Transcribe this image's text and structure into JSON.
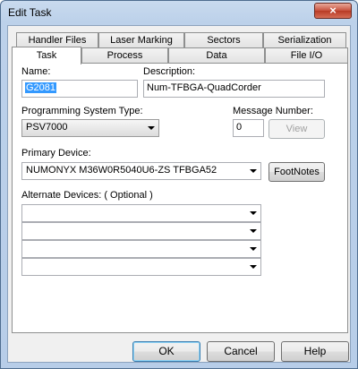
{
  "window": {
    "title": "Edit Task",
    "close_glyph": "×"
  },
  "tabs_row1": [
    "Handler Files",
    "Laser Marking",
    "Sectors",
    "Serialization"
  ],
  "tabs_row2": [
    "Task",
    "Process",
    "Data",
    "File I/O"
  ],
  "form": {
    "name_label": "Name:",
    "name_value": "G2081",
    "description_label": "Description:",
    "description_value": "Num-TFBGA-QuadCorder",
    "programming_system_label": "Programming System Type:",
    "programming_system_value": "PSV7000",
    "message_number_label": "Message Number:",
    "message_number_value": "0",
    "view_button": "View",
    "primary_device_label": "Primary Device:",
    "primary_device_value": "NUMONYX M36W0R5040U6-ZS TFBGA52",
    "footnotes_button": "FootNotes",
    "alternate_devices_label": "Alternate Devices: ( Optional )",
    "alternate_devices": [
      "",
      "",
      "",
      ""
    ]
  },
  "footer": {
    "ok": "OK",
    "cancel": "Cancel",
    "help": "Help"
  }
}
